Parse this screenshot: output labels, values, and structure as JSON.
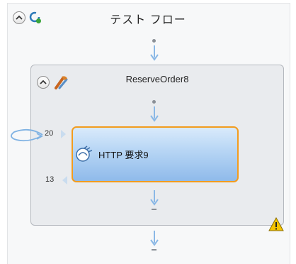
{
  "flow": {
    "title": "テスト フロー",
    "icons": [
      "collapse-icon",
      "flow-refresh-icon"
    ]
  },
  "step": {
    "title": "ReserveOrder8",
    "icons": [
      "collapse-icon",
      "step-tools-icon",
      "warning-icon"
    ]
  },
  "request": {
    "label": "HTTP 要求9",
    "icon": "http-request-icon",
    "incoming_count": "20",
    "outgoing_count": "13"
  },
  "colors": {
    "selection_border": "#f29c1e",
    "connector": "#8ab8e6",
    "warning": "#f5c400"
  }
}
